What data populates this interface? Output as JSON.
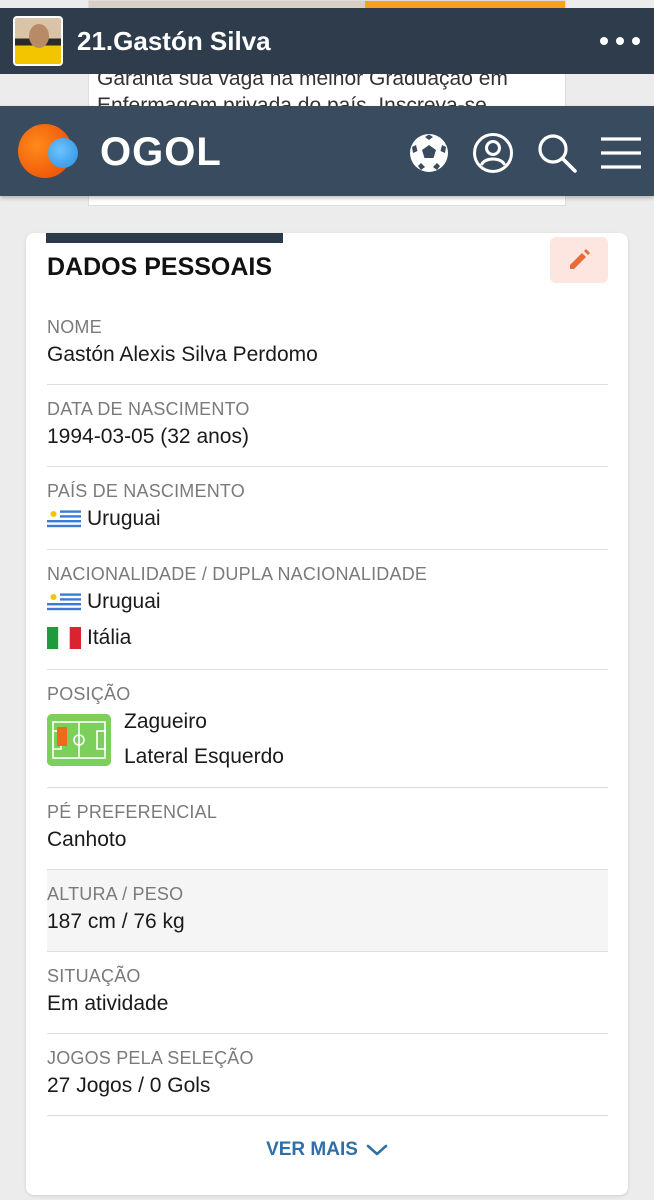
{
  "ad": {
    "text": "Garanta sua vaga na melhor Graduação em Enfermagem privada do país. Inscreva-se"
  },
  "player_bar": {
    "name": "21.Gastón Silva",
    "more_icon": "more-dots-icon"
  },
  "nav": {
    "logo_text": "OGOL",
    "icons": [
      "soccer-ball-icon",
      "user-icon",
      "search-icon",
      "menu-icon"
    ]
  },
  "card": {
    "title": "DADOS PESSOAIS",
    "edit_icon": "pencil-icon",
    "fields": {
      "name": {
        "label": "NOME",
        "value": "Gastón Alexis Silva Perdomo"
      },
      "birth": {
        "label": "DATA DE NASCIMENTO",
        "value": "1994-03-05 (32 anos)"
      },
      "country": {
        "label": "PAÍS DE NASCIMENTO",
        "value": "Uruguai"
      },
      "nationality": {
        "label": "NACIONALIDADE / DUPLA NACIONALIDADE",
        "values": [
          "Uruguai",
          "Itália"
        ]
      },
      "position": {
        "label": "POSIÇÃO",
        "values": [
          "Zagueiro",
          "Lateral Esquerdo"
        ]
      },
      "foot": {
        "label": "PÉ PREFERENCIAL",
        "value": "Canhoto"
      },
      "height_weight": {
        "label": "ALTURA / PESO",
        "value": "187 cm / 76 kg"
      },
      "status": {
        "label": "SITUAÇÃO",
        "value": "Em atividade"
      },
      "national_games": {
        "label": "JOGOS PELA SELEÇÃO",
        "value": "27 Jogos / 0 Gols"
      }
    },
    "more_label": "VER MAIS"
  },
  "colors": {
    "nav_bg": "#394b5f",
    "player_bar_bg": "#2e3c4c",
    "accent_orange": "#f05a0a",
    "link_blue": "#2f6fa8",
    "edit_bg": "#fde6df",
    "pitch_green": "#7ccf5a"
  }
}
